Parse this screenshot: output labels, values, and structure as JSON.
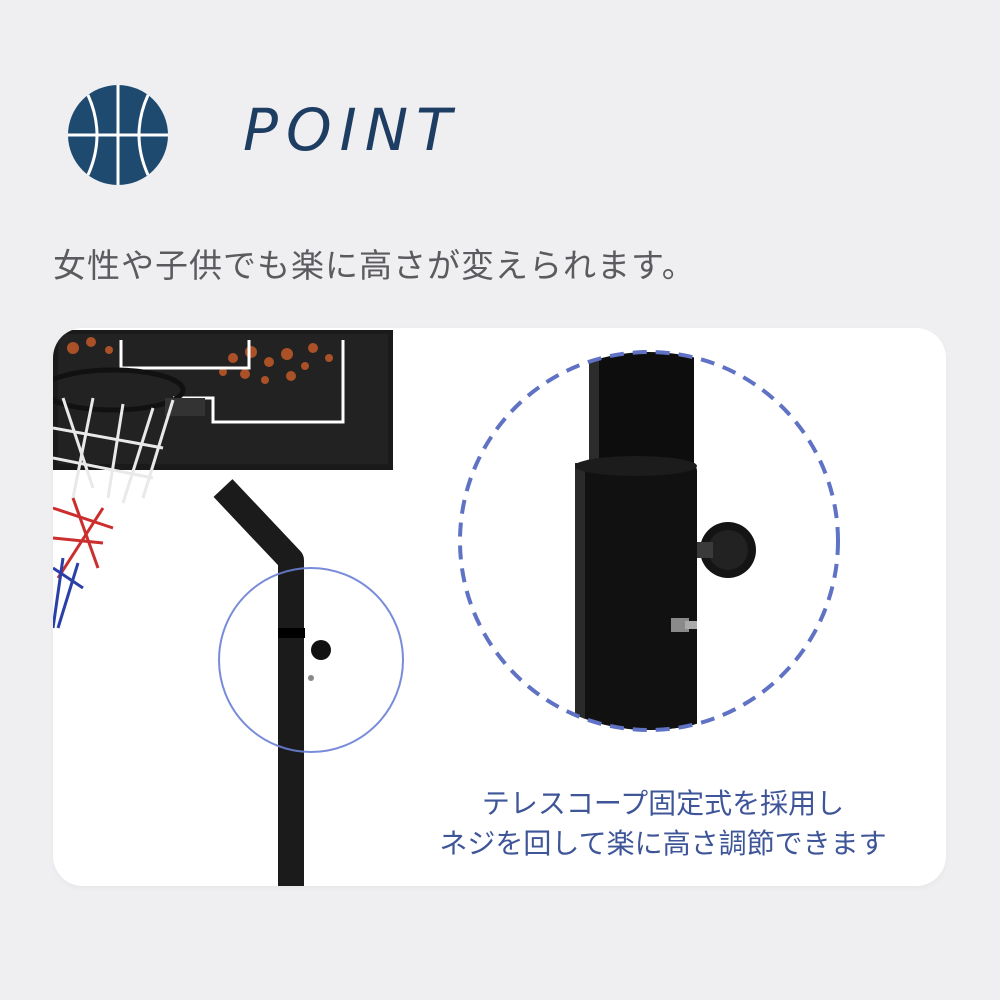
{
  "header": {
    "title": "POINT",
    "icon": "basketball-icon",
    "icon_color": "#1e4a70"
  },
  "subtitle": "女性や子供でも楽に高さが変えられます。",
  "caption": {
    "line1": "テレスコープ固定式を採用し",
    "line2": "ネジを回して楽に高さ調節できます"
  },
  "colors": {
    "background": "#efeff1",
    "card": "#ffffff",
    "title": "#1e3d62",
    "caption": "#3e5598",
    "dash_circle": "#5f72c4"
  }
}
